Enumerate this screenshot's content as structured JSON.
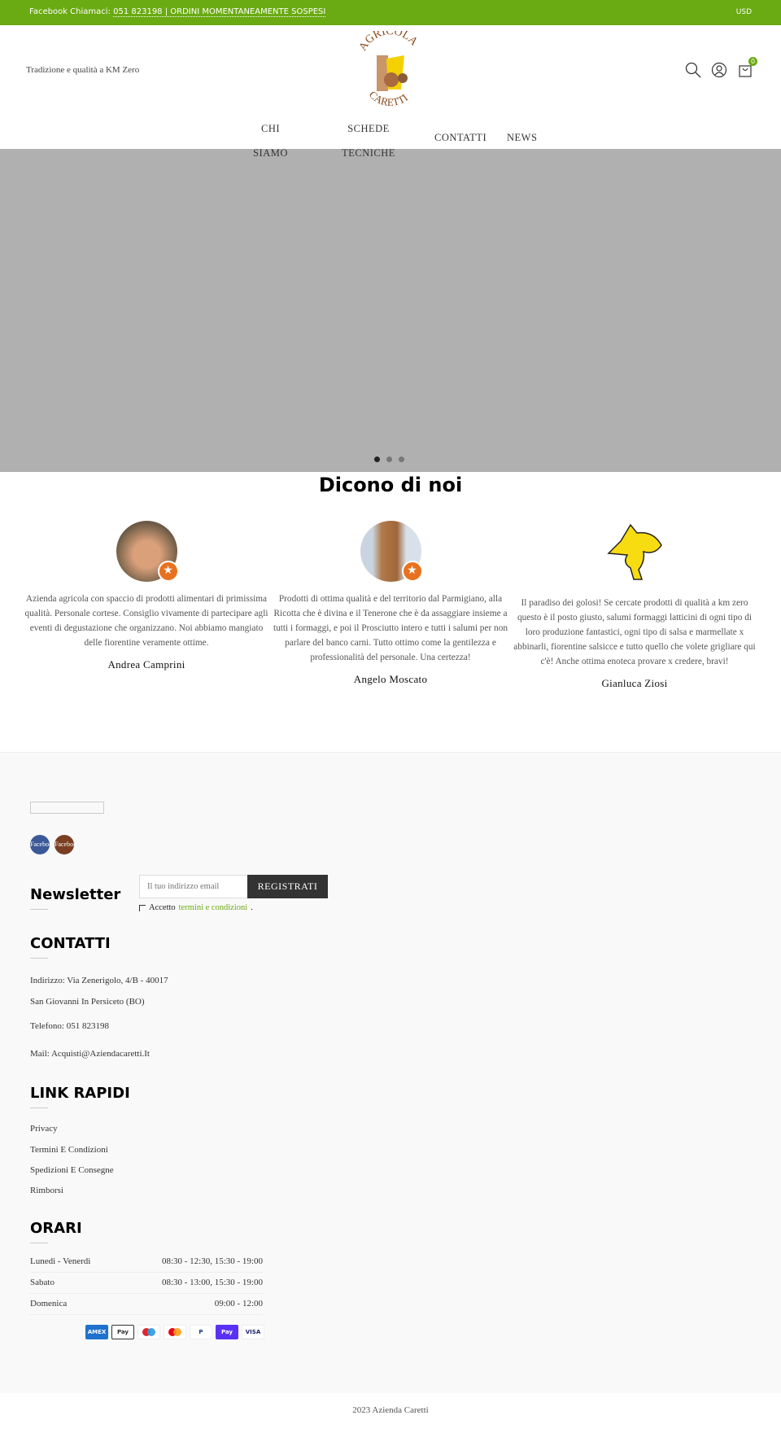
{
  "topbar": {
    "prefix": "Facebook Chiamaci:",
    "link": "051 823198 | ORDINI MOMENTANEAMENTE SOSPESI",
    "currency": "USD"
  },
  "header": {
    "tagline": "Tradizione e qualità a KM Zero",
    "logo_text": "AGRICOLA CARETTI",
    "cart_count": "0"
  },
  "nav": [
    {
      "l1": "CHI",
      "l2": "SIAMO"
    },
    {
      "l1": "SCHEDE",
      "l2": "TECNICHE"
    },
    {
      "l1": "CONTATTI"
    },
    {
      "l1": "NEWS"
    }
  ],
  "testimonials": {
    "title": "Dicono di noi",
    "items": [
      {
        "text": "Azienda agricola con spaccio di prodotti alimentari di primissima qualità. Personale cortese. Consiglio vivamente di partecipare agli eventi di degustazione che organizzano. Noi abbiamo mangiato delle fiorentine veramente ottime.",
        "name": "Andrea Camprini"
      },
      {
        "text": "Prodotti di ottima qualità e del territorio dal Parmigiano, alla Ricotta che è divina e il Tenerone che è da assaggiare insieme a tutti i formaggi, e poi il Prosciutto intero e tutti i salumi per non parlare del banco carni. Tutto ottimo come la gentilezza e professionalità del personale. Una certezza!",
        "name": "Angelo Moscato"
      },
      {
        "text": "Il paradiso dei golosi! Se cercate prodotti di qualità a km zero questo è il posto giusto, salumi formaggi latticini di ogni tipo di loro produzione fantastici, ogni tipo di salsa e marmellate x abbinarli, fiorentine salsicce e tutto quello che volete grigliare qui c'è! Anche ottima enoteca provare x credere, bravi!",
        "name": "Gianluca Ziosi"
      }
    ]
  },
  "footer": {
    "social": [
      {
        "label": "Facebook",
        "color": "#3b5998"
      },
      {
        "label": "Facebook",
        "color": "#7a3e22"
      }
    ],
    "newsletter": {
      "title": "Newsletter",
      "placeholder": "Il tuo indirizzo email",
      "button": "REGISTRATI",
      "accept": "Accetto",
      "terms": "termini e condizioni",
      "dot": "."
    },
    "contacts": {
      "title": "CONTATTI",
      "address1": "Indirizzo: Via Zenerigolo, 4/B - 40017",
      "address2": "San Giovanni In Persiceto (BO)",
      "phone": "Telefono: 051 823198",
      "mail": "Mail: Acquisti@Aziendacaretti.It"
    },
    "links": {
      "title": "LINK RAPIDI",
      "items": [
        "Privacy",
        "Termini E Condizioni",
        "Spedizioni E Consegne",
        "Rimborsi"
      ]
    },
    "hours": {
      "title": "ORARI",
      "rows": [
        {
          "day": "Lunedì - Venerdì",
          "time": "08:30 - 12:30, 15:30 - 19:00"
        },
        {
          "day": "Sabato",
          "time": "08:30 - 13:00, 15:30 - 19:00"
        },
        {
          "day": "Domenica",
          "time": "09:00 - 12:00"
        }
      ]
    },
    "payments": [
      "AMEX",
      "Apple Pay",
      "Maestro",
      "Mastercard",
      "PayPal",
      "Shop Pay",
      "VISA"
    ],
    "copyright": "2023 Azienda Caretti"
  },
  "colors": {
    "accent": "#6aaa12",
    "hero": "#b0b0b0"
  }
}
